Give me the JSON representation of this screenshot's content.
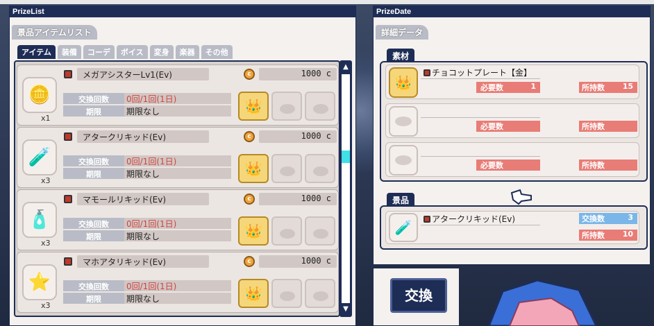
{
  "prize_list": {
    "title": "PrizeList",
    "section": "景品アイテムリスト",
    "tabs": [
      "アイテム",
      "装備",
      "コーデ",
      "ボイス",
      "変身",
      "楽器",
      "その他"
    ],
    "exchange_label": "交換回数",
    "period_label": "期限",
    "items": [
      {
        "name": "メガアシスターLv1(Ev)",
        "price": "1000 c",
        "count": "x1",
        "exchange": "0回/1回(1日)",
        "period": "期限なし",
        "icon": "lv1-emblem-icon"
      },
      {
        "name": "アタークリキッド(Ev)",
        "price": "1000 c",
        "count": "x3",
        "exchange": "0回/1回(1日)",
        "period": "期限なし",
        "icon": "red-potion-icon"
      },
      {
        "name": "マモールリキッド(Ev)",
        "price": "1000 c",
        "count": "x3",
        "exchange": "0回/1回(1日)",
        "period": "期限なし",
        "icon": "blue-potion-icon"
      },
      {
        "name": "マホアタリキッド(Ev)",
        "price": "1000 c",
        "count": "x3",
        "exchange": "0回/1回(1日)",
        "period": "期限なし",
        "icon": "red-star-potion-icon"
      }
    ],
    "coin_symbol": "c"
  },
  "prize_data": {
    "title": "PrizeDate",
    "section": "詳細データ",
    "materials_tag": "素材",
    "prize_tag": "景品",
    "required_label": "必要数",
    "owned_label": "所持数",
    "exchange_count_label": "交換数",
    "materials": [
      {
        "name": "チョコットプレート【金】",
        "required": "1",
        "owned": "15"
      },
      {
        "name": "",
        "required": "",
        "owned": ""
      },
      {
        "name": "",
        "required": "",
        "owned": ""
      }
    ],
    "prize": {
      "name": "アタークリキッド(Ev)",
      "exchange_count": "3",
      "owned": "10"
    }
  },
  "exchange_button": "交換",
  "colors": {
    "navy": "#1e2d56",
    "red_label": "#e87c76",
    "blue_label": "#7ab6e8",
    "gold": "#f6d67a"
  }
}
